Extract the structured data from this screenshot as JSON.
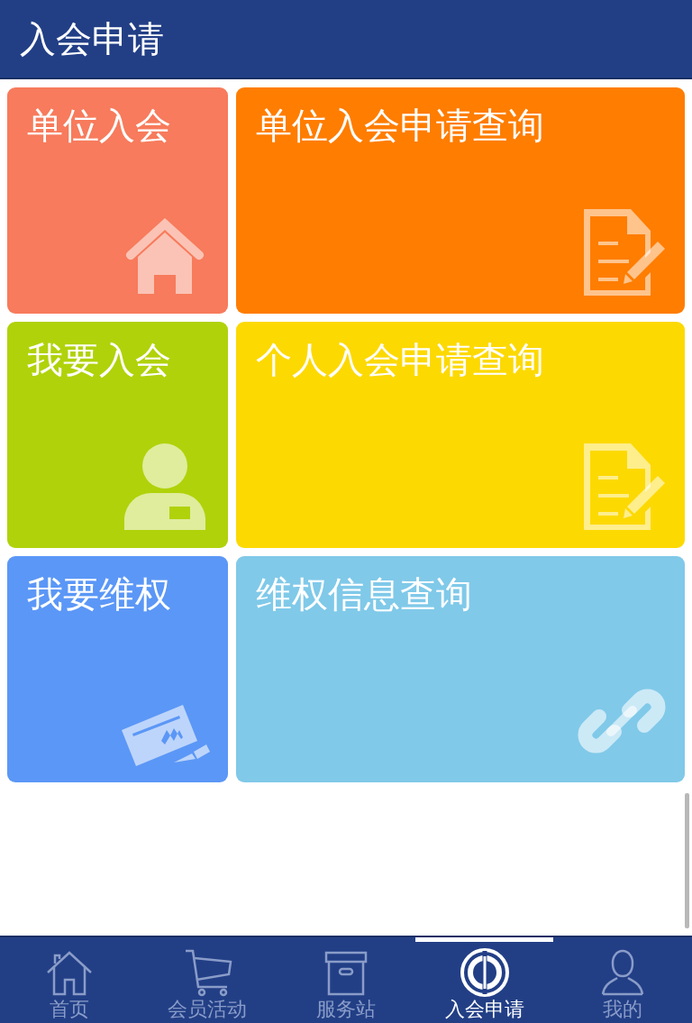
{
  "header": {
    "title": "入会申请"
  },
  "tiles": [
    {
      "label": "单位入会",
      "kind": "house",
      "color": "#f77b5c"
    },
    {
      "label": "单位入会申请查询",
      "kind": "document",
      "color": "#ff7d00"
    },
    {
      "label": "我要入会",
      "kind": "person",
      "color": "#b0d20a"
    },
    {
      "label": "个人入会申请查询",
      "kind": "document",
      "color": "#fdd902"
    },
    {
      "label": "我要维权",
      "kind": "check",
      "color": "#5b97f6"
    },
    {
      "label": "维权信息查询",
      "kind": "link",
      "color": "#80c9e9"
    }
  ],
  "bottom_nav": [
    {
      "label": "首页",
      "kind": "home",
      "selected": false
    },
    {
      "label": "会员活动",
      "kind": "cart",
      "selected": false
    },
    {
      "label": "服务站",
      "kind": "box",
      "selected": false
    },
    {
      "label": "入会申请",
      "kind": "emblem",
      "selected": true
    },
    {
      "label": "我的",
      "kind": "user",
      "selected": false
    }
  ]
}
